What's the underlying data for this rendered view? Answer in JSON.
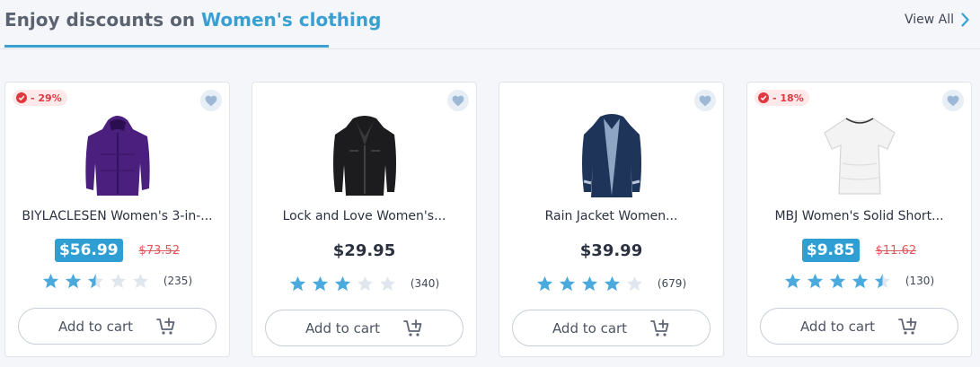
{
  "section": {
    "title_prefix": "Enjoy discounts on",
    "title_highlight": "Women's clothing",
    "view_all": "View All"
  },
  "colors": {
    "accent": "#3aa0d2",
    "star_filled": "#4aa9dd",
    "star_empty": "#dfe6ee",
    "discount_red": "#e0383e"
  },
  "products": [
    {
      "badge": "- 29%",
      "name": "BIYLACLESEN Women's 3-in-...",
      "price": "$56.99",
      "old_price": "$73.52",
      "on_sale": true,
      "rating": 2.5,
      "review_count": "(235)",
      "cart_label": "Add to cart",
      "image_icon": "purple-parka-icon"
    },
    {
      "badge": "",
      "name": "Lock and Love Women's...",
      "price": "$29.95",
      "old_price": "",
      "on_sale": false,
      "rating": 3,
      "review_count": "(340)",
      "cart_label": "Add to cart",
      "image_icon": "black-leather-jacket-icon"
    },
    {
      "badge": "",
      "name": "Rain Jacket Women...",
      "price": "$39.99",
      "old_price": "",
      "on_sale": false,
      "rating": 4,
      "review_count": "(679)",
      "cart_label": "Add to cart",
      "image_icon": "navy-rain-jacket-icon"
    },
    {
      "badge": "- 18%",
      "name": "MBJ Women's Solid Short...",
      "price": "$9.85",
      "old_price": "$11.62",
      "on_sale": true,
      "rating": 4.5,
      "review_count": "(130)",
      "cart_label": "Add to cart",
      "image_icon": "white-tshirt-icon"
    }
  ]
}
